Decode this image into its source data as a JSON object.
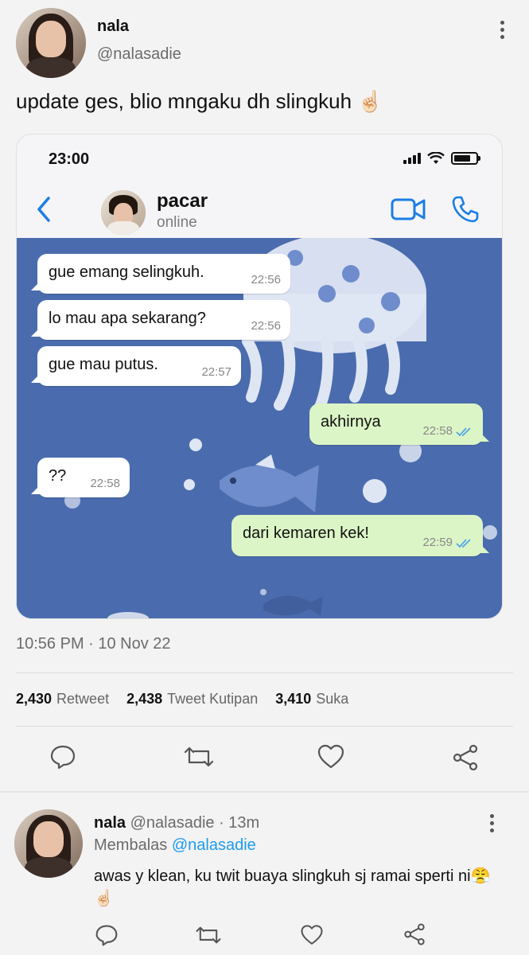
{
  "tweet": {
    "author_name": "nala",
    "author_handle": "@nalasadie",
    "text": "update ges, blio mngaku dh slingkuh ☝🏻",
    "timestamp": "10:56 PM · 10 Nov 22",
    "stats": {
      "retweets_count": "2,430",
      "retweets_label": "Retweet",
      "quotes_count": "2,438",
      "quotes_label": "Tweet Kutipan",
      "likes_count": "3,410",
      "likes_label": "Suka"
    }
  },
  "screenshot": {
    "status_time": "23:00",
    "contact_name": "pacar",
    "contact_status": "online",
    "messages": [
      {
        "side": "in",
        "text": "gue emang selingkuh.",
        "time": "22:56"
      },
      {
        "side": "in",
        "text": "lo mau apa sekarang?",
        "time": "22:56"
      },
      {
        "side": "in",
        "text": "gue mau putus.",
        "time": "22:57"
      },
      {
        "side": "out",
        "text": "akhirnya",
        "time": "22:58"
      },
      {
        "side": "in",
        "text": "??",
        "time": "22:58"
      },
      {
        "side": "out",
        "text": "dari kemaren kek!",
        "time": "22:59"
      }
    ],
    "colors": {
      "chat_bg": "#4c6fb1",
      "out_bubble": "#dcf5c6",
      "ios_blue": "#1a7ee6"
    }
  },
  "reply": {
    "author_name": "nala",
    "meta": "@nalasadie · 13m",
    "replying_label": "Membalas",
    "replying_handle": "@nalasadie",
    "text": "awas y klean, ku twit buaya slingkuh sj ramai sperti ni😤☝🏻"
  },
  "icons": [
    "more-vertical-icon",
    "back-chevron-icon",
    "video-call-icon",
    "phone-call-icon",
    "reply-icon",
    "retweet-icon",
    "like-icon",
    "share-icon",
    "read-ticks-icon"
  ]
}
